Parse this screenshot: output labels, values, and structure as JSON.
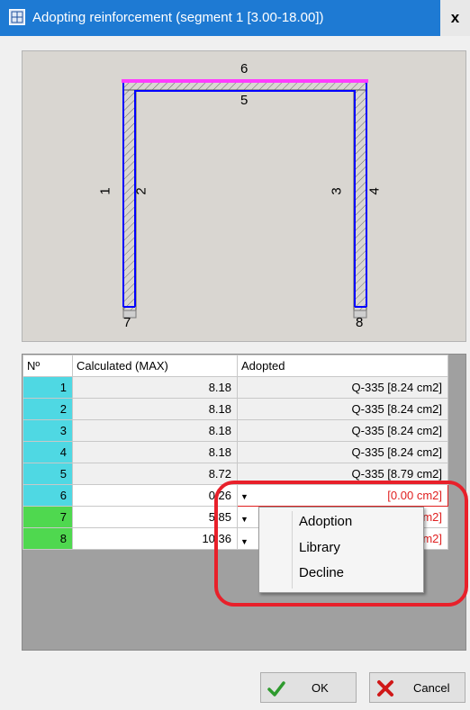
{
  "window": {
    "title": "Adopting reinforcement (segment 1 [3.00-18.00])",
    "close_label": "x"
  },
  "diagram": {
    "labels": [
      "1",
      "2",
      "3",
      "4",
      "5",
      "6",
      "7",
      "8"
    ]
  },
  "table": {
    "headers": [
      "Nº",
      "Calculated (MAX)",
      "Adopted"
    ],
    "rows": [
      {
        "index": "1",
        "calculated": "8.18",
        "adopted": "Q-335 [8.24 cm2]"
      },
      {
        "index": "2",
        "calculated": "8.18",
        "adopted": "Q-335 [8.24 cm2]"
      },
      {
        "index": "3",
        "calculated": "8.18",
        "adopted": "Q-335 [8.24 cm2]"
      },
      {
        "index": "4",
        "calculated": "8.18",
        "adopted": "Q-335 [8.24 cm2]"
      },
      {
        "index": "5",
        "calculated": "8.72",
        "adopted": "Q-335 [8.79 cm2]"
      },
      {
        "index": "6",
        "calculated": "0.26",
        "adopted": "[0.00 cm2]"
      },
      {
        "index": "7",
        "calculated": "5.85",
        "adopted": "m2]"
      },
      {
        "index": "8",
        "calculated": "10.36",
        "adopted": "m2]"
      }
    ]
  },
  "context_menu": {
    "items": [
      "Adoption",
      "Library",
      "Decline"
    ]
  },
  "buttons": {
    "ok": "OK",
    "cancel": "Cancel"
  },
  "colors": {
    "title_bar": "#1e7ad3",
    "row_index_cyan": "#4fd8e3",
    "row_index_green": "#4fd84f",
    "highlight": "#e8202a",
    "frame_top": "#ff3cff",
    "rebar": "#0000ff"
  }
}
